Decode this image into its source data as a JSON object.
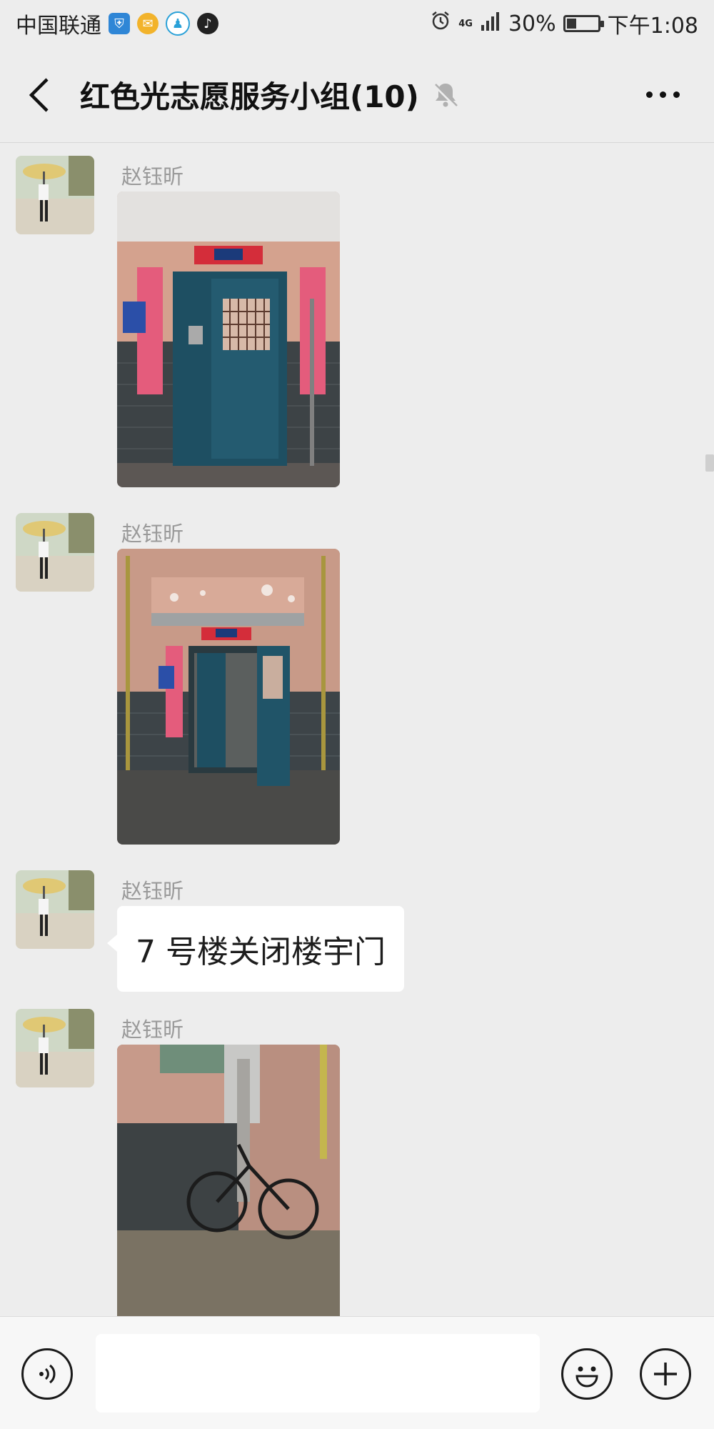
{
  "status_bar": {
    "carrier": "中国联通",
    "network": "4G",
    "battery_percent": "30%",
    "battery_level": 0.3,
    "time": "下午1:08",
    "icons": [
      "shield-icon",
      "mail-icon",
      "qq-icon",
      "tiktok-icon",
      "alarm-icon",
      "signal-icon",
      "battery-icon"
    ]
  },
  "header": {
    "back_icon": "chevron-left-icon",
    "title": "红色光志愿服务小组(10)",
    "mute_icon": "bell-muted-icon",
    "more_icon": "more-dots-icon"
  },
  "messages": [
    {
      "sender": "赵钰昕",
      "type": "image",
      "image": "apartment-unit-door-closed"
    },
    {
      "sender": "赵钰昕",
      "type": "image",
      "image": "apartment-unit-door-open"
    },
    {
      "sender": "赵钰昕",
      "type": "text",
      "text": "7 号楼关闭楼宇门"
    },
    {
      "sender": "赵钰昕",
      "type": "image",
      "image": "bicycle-by-wall"
    }
  ],
  "input_bar": {
    "voice_icon": "voice-icon",
    "text_value": "",
    "emoji_icon": "emoji-icon",
    "plus_icon": "plus-icon"
  },
  "colors": {
    "background": "#ededed",
    "bubble": "#ffffff",
    "sender_name": "#9a9a9a",
    "door": "#1f4f63",
    "wall_pink": "#d9a48f"
  }
}
